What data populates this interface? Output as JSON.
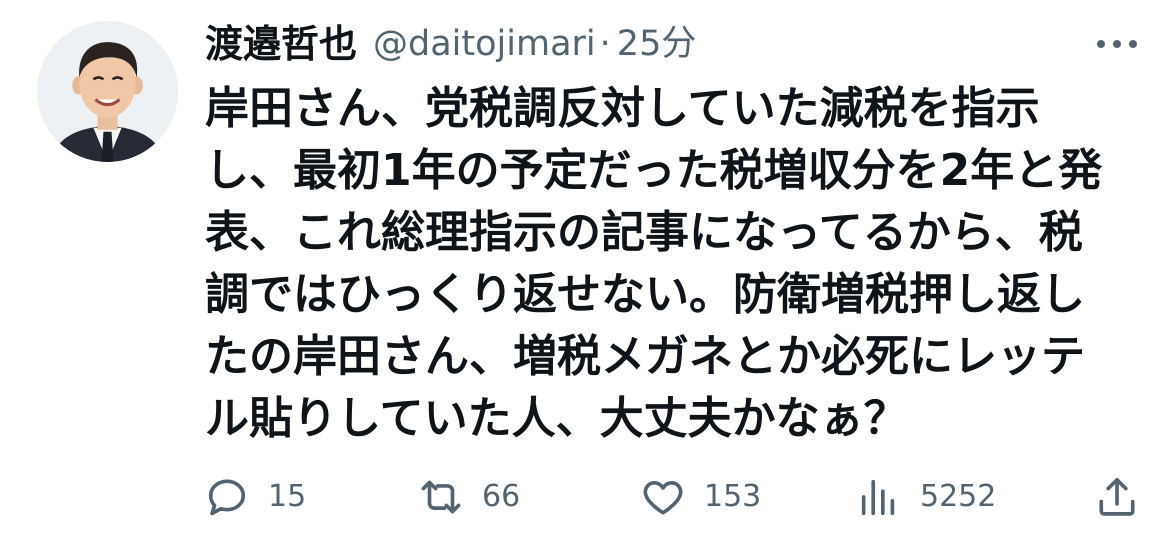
{
  "post": {
    "author_name": "渡邉哲也",
    "handle": "@daitojimari",
    "separator": "·",
    "time": "25分",
    "text_lines": [
      "岸田さん、党税調反対していた減税を指示",
      "し、最初1年の予定だった税増収分を2年と発",
      "表、これ総理指示の記事になってるから、税",
      "調ではひっくり返せない。防衛増税押し返し",
      "たの岸田さん、増税メガネとか必死にレッテ",
      "ル貼りしていた人、大丈夫かなぁ？"
    ]
  },
  "actions": {
    "replies": "15",
    "reposts": "66",
    "likes": "153",
    "views": "5252"
  },
  "icons": {
    "avatar": "avatar-photo",
    "more": "more-icon",
    "reply": "reply-icon",
    "repost": "repost-icon",
    "like": "like-icon",
    "views": "views-icon",
    "share": "share-icon"
  },
  "colors": {
    "text": "#0f1419",
    "secondary": "#536471",
    "background": "#ffffff"
  }
}
